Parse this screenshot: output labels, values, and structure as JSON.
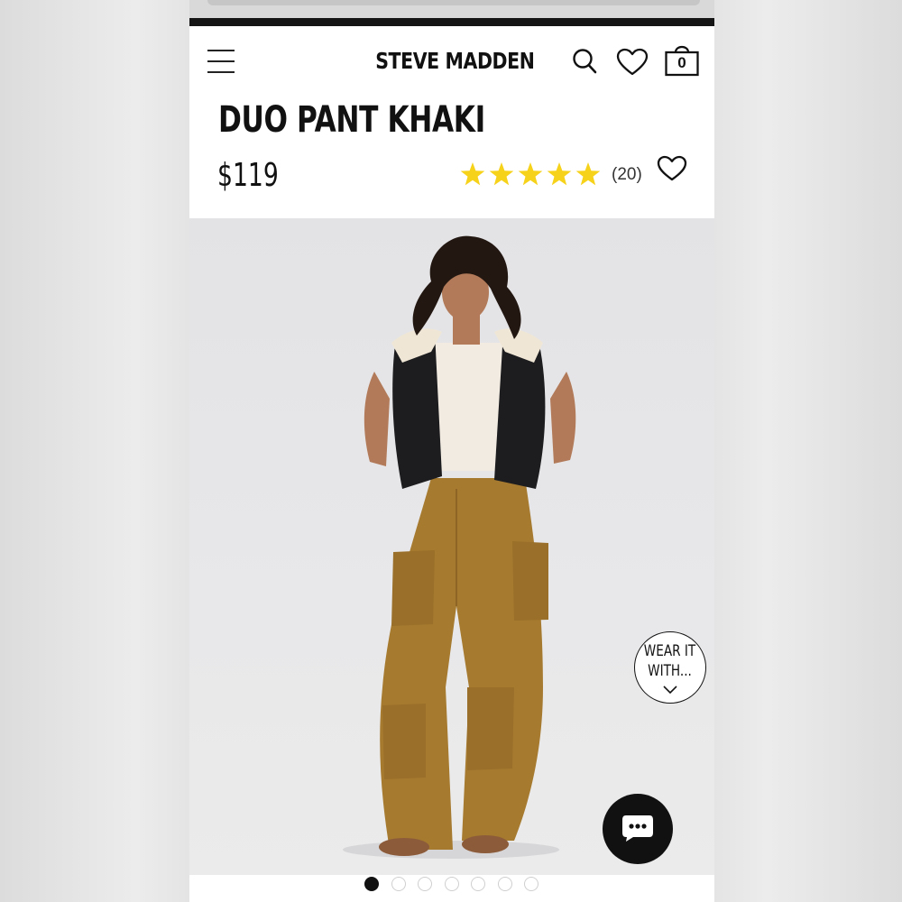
{
  "header": {
    "brand": "STEVE MADDEN",
    "bag_count": "0"
  },
  "product": {
    "title": "DUO PANT KHAKI",
    "price": "$119",
    "rating": 5,
    "review_count": "(20)"
  },
  "wear_it_with": {
    "label": "WEAR IT\nWITH..."
  },
  "gallery": {
    "total_images": 7,
    "active_index": 0
  },
  "colors": {
    "star": "#f6d21a",
    "ink": "#111111",
    "dot_inactive": "#cfcfcf"
  },
  "icons": [
    "menu-icon",
    "search-icon",
    "heart-icon",
    "shopping-bag-icon",
    "star-icon",
    "chevron-down-icon",
    "chat-icon"
  ]
}
